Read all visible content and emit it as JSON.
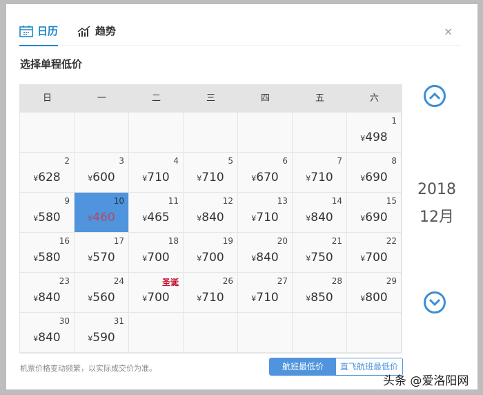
{
  "tabs": [
    {
      "label": "日历",
      "icon": "calendar-icon"
    },
    {
      "label": "趋势",
      "icon": "trend-chart-icon"
    }
  ],
  "close_label": "×",
  "title": "选择单程低价",
  "weekdays": [
    "日",
    "一",
    "二",
    "三",
    "四",
    "五",
    "六"
  ],
  "currency": "¥",
  "weeks": [
    [
      null,
      null,
      null,
      null,
      null,
      null,
      {
        "day": "1",
        "price": "498"
      }
    ],
    [
      {
        "day": "2",
        "price": "628"
      },
      {
        "day": "3",
        "price": "600"
      },
      {
        "day": "4",
        "price": "710"
      },
      {
        "day": "5",
        "price": "710"
      },
      {
        "day": "6",
        "price": "670"
      },
      {
        "day": "7",
        "price": "710"
      },
      {
        "day": "8",
        "price": "690"
      }
    ],
    [
      {
        "day": "9",
        "price": "580"
      },
      {
        "day": "10",
        "price": "460",
        "selected": true
      },
      {
        "day": "11",
        "price": "465"
      },
      {
        "day": "12",
        "price": "840"
      },
      {
        "day": "13",
        "price": "710"
      },
      {
        "day": "14",
        "price": "840"
      },
      {
        "day": "15",
        "price": "690"
      }
    ],
    [
      {
        "day": "16",
        "price": "580"
      },
      {
        "day": "17",
        "price": "570"
      },
      {
        "day": "18",
        "price": "700"
      },
      {
        "day": "19",
        "price": "700"
      },
      {
        "day": "20",
        "price": "840"
      },
      {
        "day": "21",
        "price": "750"
      },
      {
        "day": "22",
        "price": "700"
      }
    ],
    [
      {
        "day": "23",
        "price": "840"
      },
      {
        "day": "24",
        "price": "560"
      },
      {
        "day": "圣诞",
        "price": "700",
        "holiday": true
      },
      {
        "day": "26",
        "price": "710"
      },
      {
        "day": "27",
        "price": "710"
      },
      {
        "day": "28",
        "price": "850"
      },
      {
        "day": "29",
        "price": "800"
      }
    ],
    [
      {
        "day": "30",
        "price": "840"
      },
      {
        "day": "31",
        "price": "590"
      },
      null,
      null,
      null,
      null,
      null
    ]
  ],
  "year": "2018",
  "month": "12月",
  "note": "机票价格变动频繁，以实际成交价为准。",
  "toggle": [
    "航班最低价",
    "直飞航班最低价"
  ],
  "watermark": "头条 @爱洛阳网",
  "colors": {
    "accent": "#4f94dc",
    "holiday": "#c0102c"
  }
}
